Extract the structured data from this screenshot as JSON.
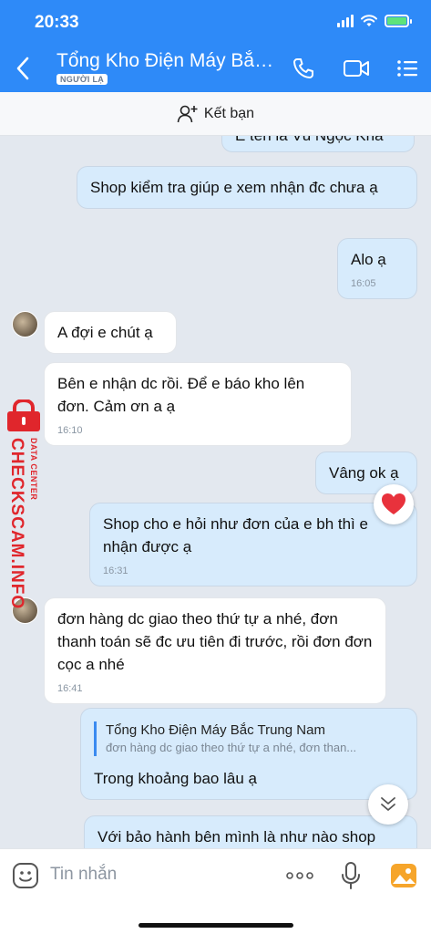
{
  "status": {
    "time": "20:33"
  },
  "header": {
    "title": "Tổng Kho Điện Máy Bắc...",
    "badge": "NGƯỜI LẠ",
    "icons": [
      "back-icon",
      "phone-icon",
      "video-icon",
      "menu-icon"
    ]
  },
  "friend_bar": {
    "label": "Kết bạn"
  },
  "messages": [
    {
      "from": "me",
      "text": "E tên là Vũ Ngọc Khá"
    },
    {
      "from": "me",
      "text": "Shop kiểm tra giúp e xem nhận đc chưa ạ"
    },
    {
      "from": "me",
      "text": "Alo ạ",
      "time": "16:05"
    },
    {
      "from": "them",
      "text": "A đợi e chút ạ"
    },
    {
      "from": "them",
      "text": "Bên e nhận dc rồi. Để e báo kho lên đơn. Cảm ơn a ạ",
      "time": "16:10"
    },
    {
      "from": "me",
      "text": "Vâng ok ạ"
    },
    {
      "from": "me",
      "text": "Shop cho e hỏi như đơn của e bh thì e nhận được ạ",
      "time": "16:31"
    },
    {
      "from": "them",
      "text": "đơn hàng dc giao theo thứ tự a nhé, đơn thanh toán sẽ đc ưu tiên đi trước, rồi đơn đơn cọc a nhé",
      "time": "16:41"
    },
    {
      "from": "me",
      "quote_name": "Tổng Kho Điện Máy Bắc Trung Nam",
      "quote_text": "đơn hàng dc giao theo thứ tự a nhé, đơn than...",
      "text": "Trong khoảng bao lâu ạ"
    },
    {
      "from": "me",
      "text": "Với bảo hành bên mình là như nào shop"
    }
  ],
  "watermark": {
    "brand": "CHECKSCAM.INFO",
    "tag": "DATA CENTER"
  },
  "input": {
    "placeholder": "Tin nhắn",
    "icons": [
      "sticker-icon",
      "more-icon",
      "microphone-icon",
      "image-icon"
    ]
  },
  "colors": {
    "header": "#2e8af8",
    "my_bubble": "#d7ebfc",
    "their_bubble": "#ffffff",
    "watermark": "#e0262c"
  }
}
